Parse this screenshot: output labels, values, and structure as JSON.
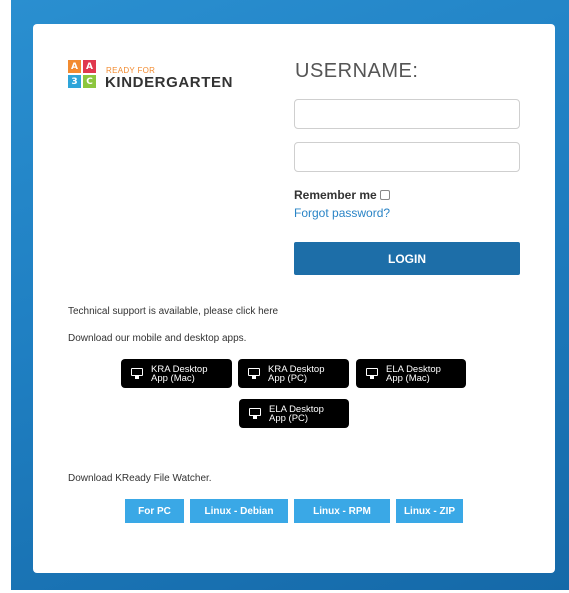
{
  "logo": {
    "blocks": [
      "A",
      "A",
      "3",
      "C"
    ],
    "small_text": "READY FOR",
    "big_text": "KINDERGARTEN"
  },
  "login": {
    "username_heading": "USERNAME:",
    "username_value": "",
    "password_value": "",
    "remember_label": "Remember me",
    "remember_checked": false,
    "forgot_link": "Forgot password?",
    "login_button": "LOGIN"
  },
  "support": {
    "tech_text": "Technical support is available, please click here",
    "download_apps_text": "Download our mobile and desktop apps."
  },
  "apps": [
    {
      "label": "KRA Desktop\nApp  (Mac)",
      "icon": "monitor-icon"
    },
    {
      "label": "KRA Desktop\nApp  (PC)",
      "icon": "monitor-icon"
    },
    {
      "label": "ELA Desktop\nApp (Mac)",
      "icon": "monitor-icon"
    },
    {
      "label": "ELA Desktop\nApp (PC)",
      "icon": "monitor-icon"
    }
  ],
  "file_watcher": {
    "text": "Download KReady File Watcher.",
    "buttons": [
      "For PC",
      "Linux - Debian",
      "Linux - RPM",
      "Linux - ZIP"
    ]
  },
  "colors": {
    "background": "#1f7fc2",
    "login_button": "#1d6ea8",
    "watcher_button": "#3aa8e6",
    "link": "#2a84c6"
  }
}
